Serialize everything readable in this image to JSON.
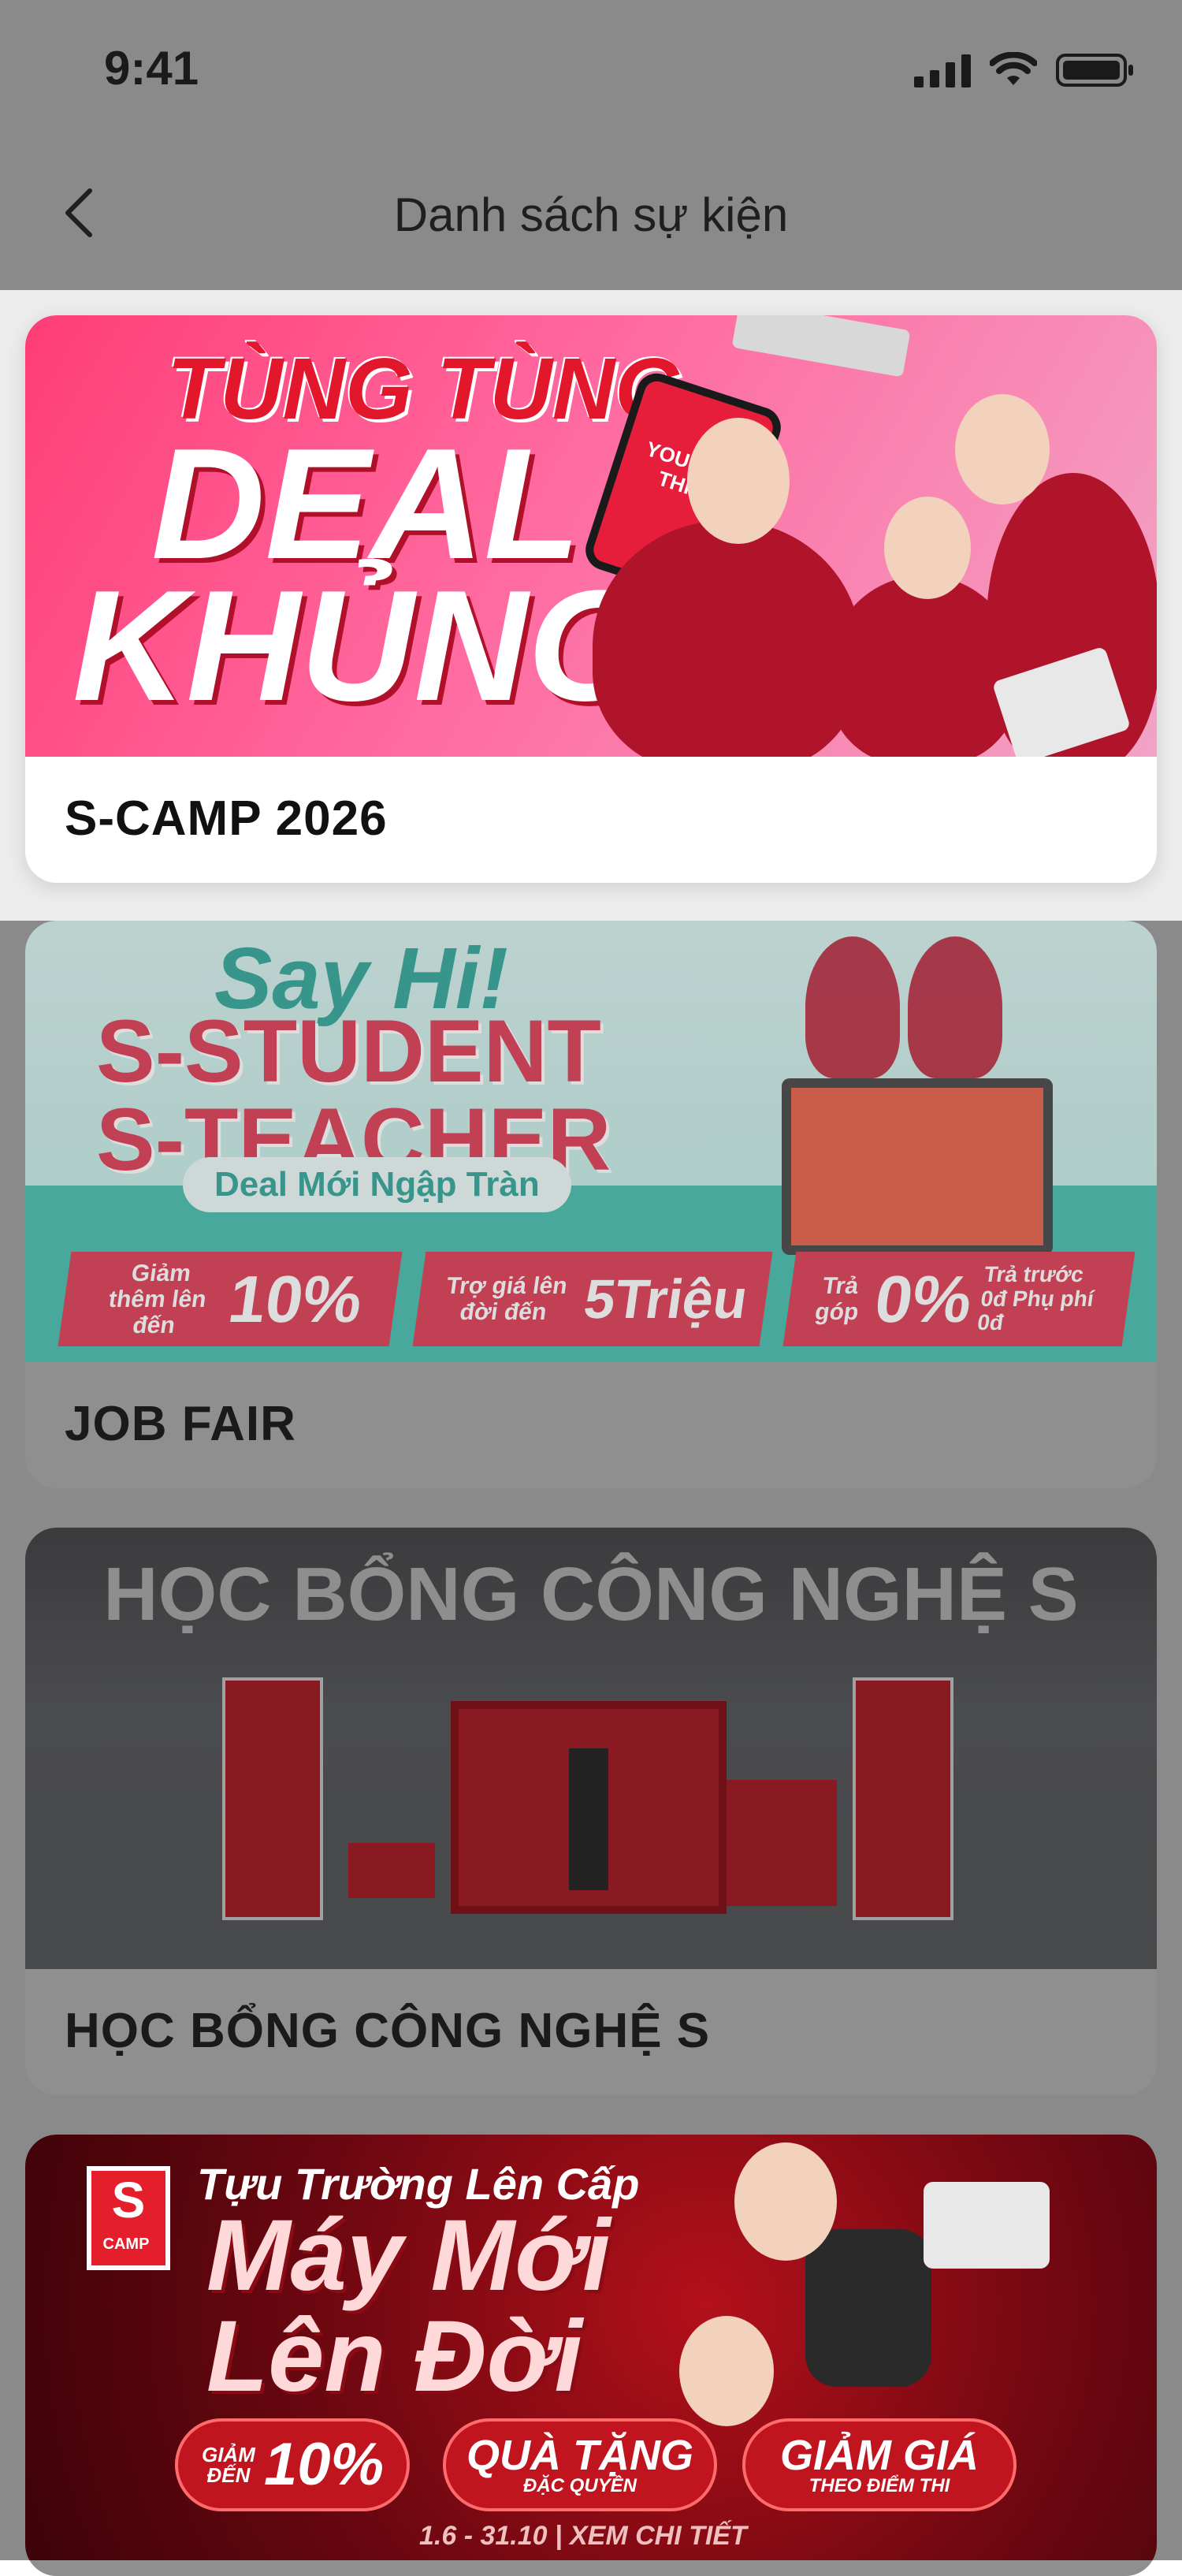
{
  "status_bar": {
    "time": "9:41"
  },
  "nav": {
    "title": "Danh sách sự kiện",
    "back_icon": "chevron-left-icon"
  },
  "events": [
    {
      "title": "S-CAMP 2026",
      "banner": {
        "line1": "TÙNG TÙNG",
        "line2": "DEAL",
        "line3": "KHỦNG",
        "phone_text": "YOU GOT THIS!"
      }
    },
    {
      "title": "JOB FAIR",
      "banner": {
        "greeting": "Say Hi!",
        "line1": "S-STUDENT",
        "line2": "S-TEACHER",
        "pill": "Deal Mới Ngập Tràn",
        "promo1_small": "Giảm thêm lên đến",
        "promo1_big": "10%",
        "promo2_small": "Trợ giá lên đời đến",
        "promo2_big": "5Triệu",
        "promo3_small": "Trả góp",
        "promo3_big": "0%",
        "promo3_side": "Trả trước 0đ Phụ phí 0đ"
      }
    },
    {
      "title": "HỌC BỔNG CÔNG NGHỆ S",
      "banner": {
        "headline": "HỌC BỔNG CÔNG NGHỆ S"
      }
    },
    {
      "title": "",
      "banner": {
        "logo": "S",
        "logo_sub": "CAMP",
        "tagline": "Tựu Trường Lên Cấp",
        "big1": "Máy Mới",
        "big2": "Lên Đời",
        "chip1_small": "GIẢM ĐẾN",
        "chip1_big": "10%",
        "chip2_big": "QUÀ TẶNG",
        "chip2_small": "ĐẶC QUYỀN",
        "chip3_big": "GIẢM GIÁ",
        "chip3_small": "THEO ĐIỂM THI",
        "date": "1.6 - 31.10  |  XEM CHI TIẾT"
      }
    }
  ]
}
